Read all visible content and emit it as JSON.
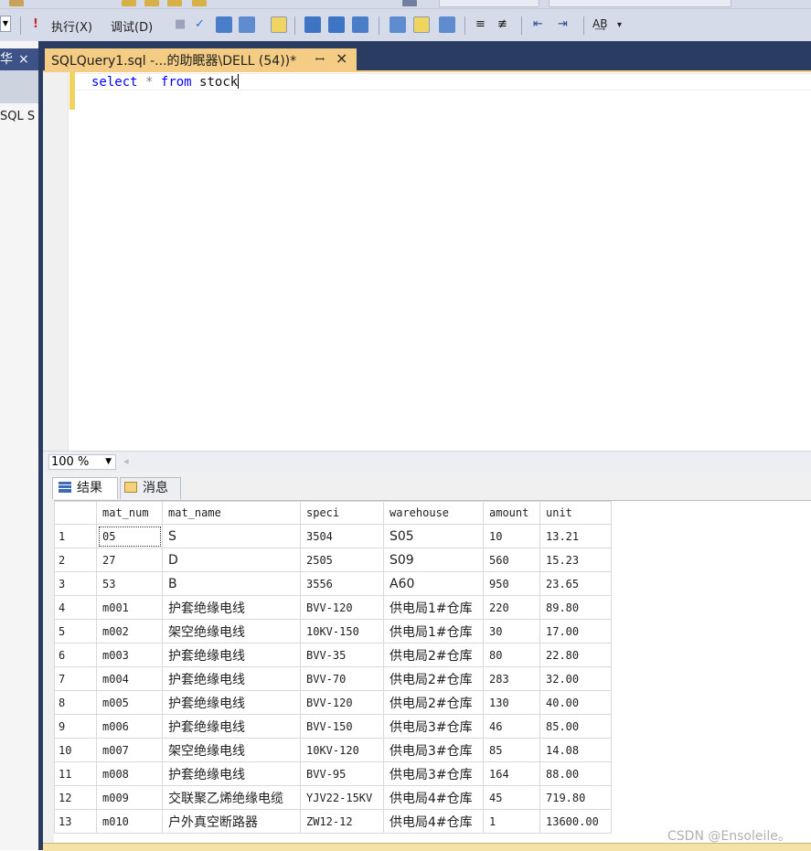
{
  "toolbar": {
    "execute_label": "执行(X)",
    "debug_label": "调试(D)"
  },
  "left_pane": {
    "pin_glyph": "华",
    "close_glyph": "×",
    "item_label": "SQL S"
  },
  "document_tab": {
    "title": "SQLQuery1.sql -...的助眠器\\DELL (54))*",
    "pin_glyph": "↕",
    "close_glyph": "×"
  },
  "editor": {
    "keyword_select": "select",
    "operator": "*",
    "keyword_from": "from",
    "table_name": "stock"
  },
  "zoom": {
    "value": "100 %"
  },
  "results_tabs": {
    "results_label": "结果",
    "messages_label": "消息"
  },
  "grid": {
    "columns": [
      "mat_num",
      "mat_name",
      "speci",
      "warehouse",
      "amount",
      "unit"
    ],
    "rows": [
      {
        "n": "1",
        "mat_num": "05",
        "mat_name": "S",
        "speci": "3504",
        "warehouse": "S05",
        "amount": "10",
        "unit": "13.21"
      },
      {
        "n": "2",
        "mat_num": "27",
        "mat_name": "D",
        "speci": "2505",
        "warehouse": "S09",
        "amount": "560",
        "unit": "15.23"
      },
      {
        "n": "3",
        "mat_num": "53",
        "mat_name": "B",
        "speci": "3556",
        "warehouse": "A60",
        "amount": "950",
        "unit": "23.65"
      },
      {
        "n": "4",
        "mat_num": "m001",
        "mat_name": "护套绝缘电线",
        "speci": "BVV-120",
        "warehouse": "供电局1#仓库",
        "amount": "220",
        "unit": "89.80"
      },
      {
        "n": "5",
        "mat_num": "m002",
        "mat_name": "架空绝缘电线",
        "speci": "10KV-150",
        "warehouse": "供电局1#仓库",
        "amount": "30",
        "unit": "17.00"
      },
      {
        "n": "6",
        "mat_num": "m003",
        "mat_name": "护套绝缘电线",
        "speci": "BVV-35",
        "warehouse": "供电局2#仓库",
        "amount": "80",
        "unit": "22.80"
      },
      {
        "n": "7",
        "mat_num": "m004",
        "mat_name": "护套绝缘电线",
        "speci": "BVV-70",
        "warehouse": "供电局2#仓库",
        "amount": "283",
        "unit": "32.00"
      },
      {
        "n": "8",
        "mat_num": "m005",
        "mat_name": "护套绝缘电线",
        "speci": "BVV-120",
        "warehouse": "供电局2#仓库",
        "amount": "130",
        "unit": "40.00"
      },
      {
        "n": "9",
        "mat_num": "m006",
        "mat_name": "护套绝缘电线",
        "speci": "BVV-150",
        "warehouse": "供电局3#仓库",
        "amount": "46",
        "unit": "85.00"
      },
      {
        "n": "10",
        "mat_num": "m007",
        "mat_name": "架空绝缘电线",
        "speci": "10KV-120",
        "warehouse": "供电局3#仓库",
        "amount": "85",
        "unit": "14.08"
      },
      {
        "n": "11",
        "mat_num": "m008",
        "mat_name": "护套绝缘电线",
        "speci": "BVV-95",
        "warehouse": "供电局3#仓库",
        "amount": "164",
        "unit": "88.00"
      },
      {
        "n": "12",
        "mat_num": "m009",
        "mat_name": "交联聚乙烯绝缘电缆",
        "speci": "YJV22-15KV",
        "warehouse": "供电局4#仓库",
        "amount": "45",
        "unit": "719.80"
      },
      {
        "n": "13",
        "mat_num": "m010",
        "mat_name": "户外真空断路器",
        "speci": "ZW12-12",
        "warehouse": "供电局4#仓库",
        "amount": "1",
        "unit": "13600.00"
      }
    ]
  },
  "watermark": "CSDN @Ensoleile。",
  "colors": {
    "toolbar_bg": "#d6dbe9",
    "tab_active": "#f5cc84",
    "frame_dark": "#2b3c63",
    "keyword_blue": "#0000ff"
  },
  "icons": [
    "execute-icon",
    "check-icon",
    "parse-icon",
    "results-grid-icon",
    "messages-icon",
    "dropdown-arrow-icon",
    "pin-icon",
    "close-icon"
  ]
}
